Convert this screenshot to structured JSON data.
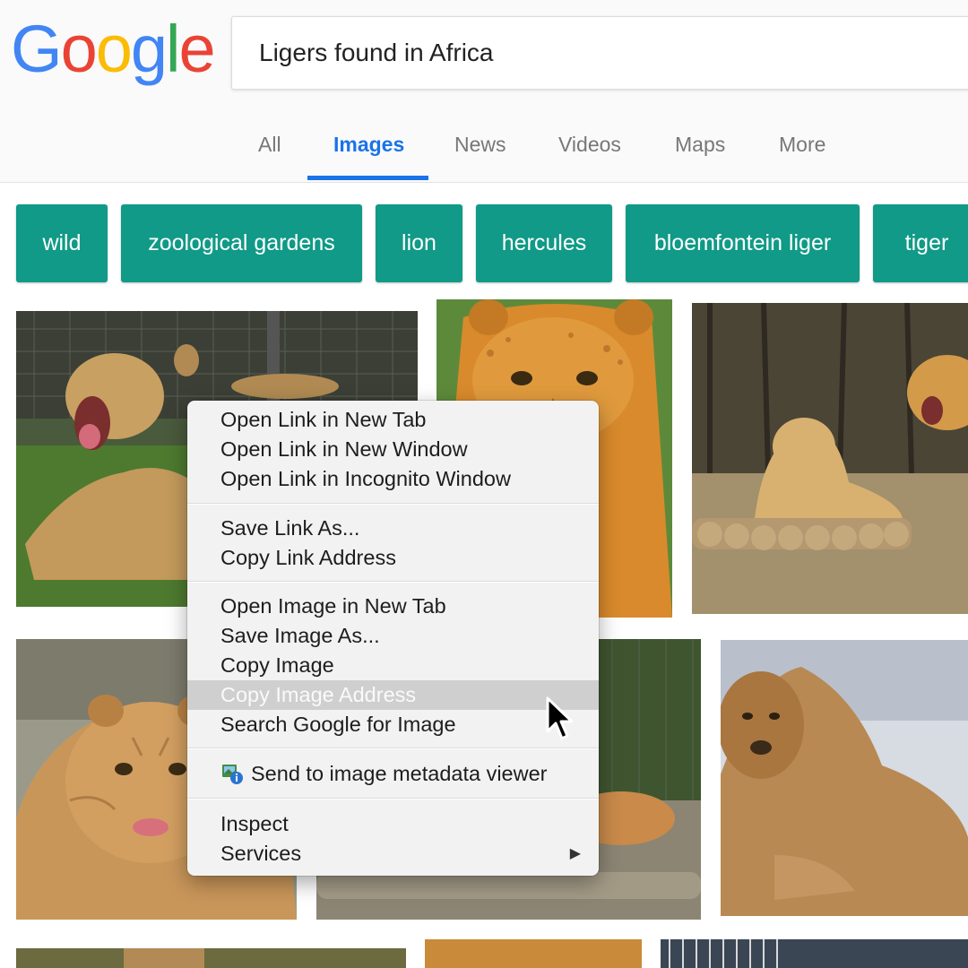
{
  "logo": {
    "letters": [
      "G",
      "o",
      "o",
      "g",
      "l",
      "e"
    ],
    "colors": [
      "#4285f4",
      "#ea4335",
      "#fbbc05",
      "#4285f4",
      "#34a853",
      "#ea4335"
    ]
  },
  "search": {
    "query": "Ligers found in Africa"
  },
  "tabs": [
    {
      "label": "All",
      "active": false
    },
    {
      "label": "Images",
      "active": true
    },
    {
      "label": "News",
      "active": false
    },
    {
      "label": "Videos",
      "active": false
    },
    {
      "label": "Maps",
      "active": false
    },
    {
      "label": "More",
      "active": false
    }
  ],
  "chips": [
    "wild",
    "zoological gardens",
    "lion",
    "hercules",
    "bloemfontein liger",
    "tiger"
  ],
  "colors": {
    "chip_bg": "#109a87",
    "accent": "#1a73e8",
    "menu_bg": "#f2f2f2",
    "menu_highlight": "#cfcfcf"
  },
  "context_menu": {
    "groups": [
      [
        "Open Link in New Tab",
        "Open Link in New Window",
        "Open Link in Incognito Window"
      ],
      [
        "Save Link As...",
        "Copy Link Address"
      ],
      [
        "Open Image in New Tab",
        "Save Image As...",
        "Copy Image",
        "Copy Image Address",
        "Search Google for Image"
      ],
      [
        "Send to image metadata viewer"
      ],
      [
        "Inspect",
        "Services"
      ]
    ],
    "highlighted": "Copy Image Address",
    "extension_icon": "metadata-viewer-icon",
    "submenu_arrow": "▶"
  }
}
